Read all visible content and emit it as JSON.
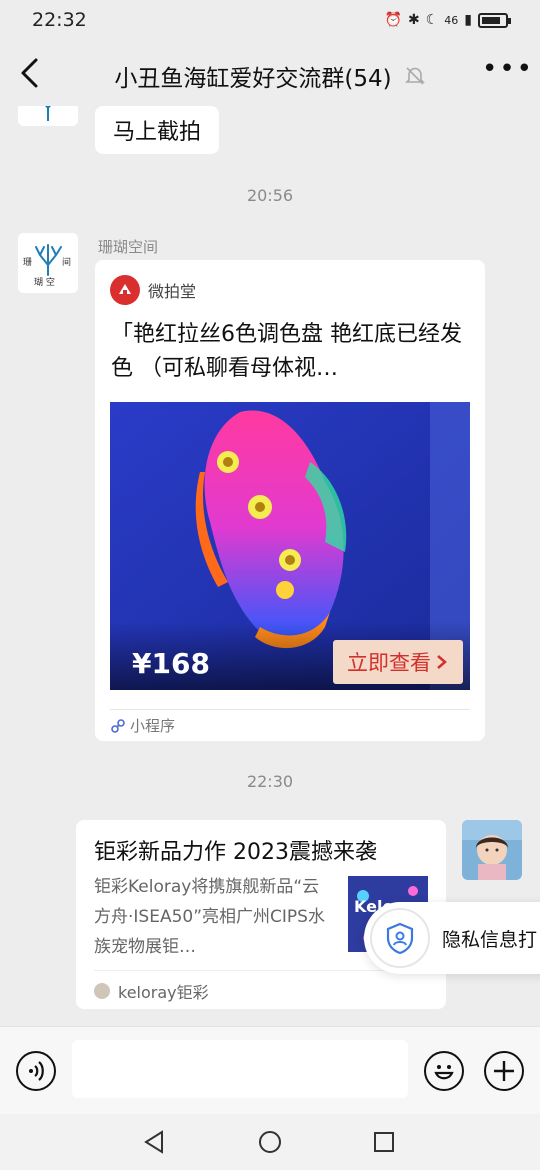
{
  "status_bar": {
    "time": "22:32",
    "network": "46"
  },
  "header": {
    "title": "小丑鱼海缸爱好交流群(54)"
  },
  "messages": {
    "m1_text": "马上截拍",
    "ts1": "20:56",
    "m2_sender": "珊瑚空间",
    "m2_avatar_text": "珊 间 瑚 空",
    "mini_program": {
      "source": "微拍堂",
      "title": "「艳红拉丝6色调色盘 艳红底已经发色 （可私聊看母体视…",
      "price": "¥168",
      "button": "立即查看",
      "footer": "小程序"
    },
    "ts2": "22:30",
    "article": {
      "title": "钜彩新品力作 2023震撼来袭",
      "desc": "钜彩Keloray将携旗舰新品“云方舟·ISEA50”亮相广州CIPS水族宠物展钜…",
      "source": "keloray钜彩",
      "thumb_text": "Kelo"
    }
  },
  "privacy_popup": {
    "label": "隐私信息打"
  },
  "colors": {
    "background": "#ededed",
    "bubble": "#ffffff",
    "accent_red": "#d2302c"
  }
}
